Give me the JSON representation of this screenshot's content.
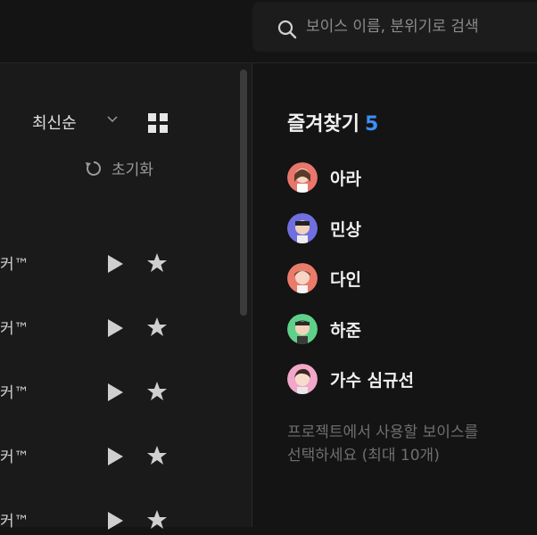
{
  "search": {
    "placeholder": "보이스 이름, 분위기로 검색"
  },
  "toolbar": {
    "sort_label": "최신순",
    "reset_label": "초기화"
  },
  "voice_list": {
    "rows": [
      {
        "name": "커™"
      },
      {
        "name": "커™"
      },
      {
        "name": "커™"
      },
      {
        "name": "커™"
      },
      {
        "name": "커™"
      }
    ]
  },
  "favorites": {
    "title": "즐겨찾기",
    "count": "5",
    "items": [
      {
        "label": "아라",
        "avatar_color": "#e8766a"
      },
      {
        "label": "민상",
        "avatar_color": "#6f6fe0"
      },
      {
        "label": "다인",
        "avatar_color": "#ea7b6a"
      },
      {
        "label": "하준",
        "avatar_color": "#5fd08a"
      },
      {
        "label": "가수 심규선",
        "avatar_color": "#f2a6c8"
      }
    ],
    "hint_line1": "프로젝트에서 사용할 보이스를",
    "hint_line2": "선택하세요 (최대 10개)"
  }
}
